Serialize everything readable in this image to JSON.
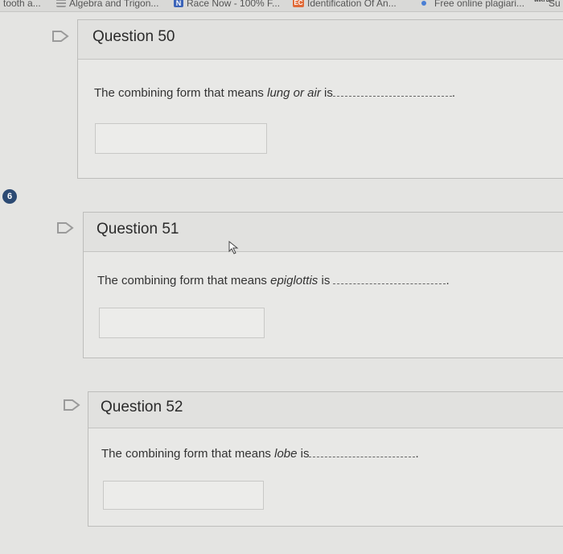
{
  "bookmarks": [
    {
      "label": "tooth a...",
      "icon": "none"
    },
    {
      "label": "Algebra and Trigon...",
      "icon": "stack-icon"
    },
    {
      "label": "Race Now - 100% F...",
      "icon": "n-logo-icon"
    },
    {
      "label": "Identification Of An...",
      "icon": "ec-logo-icon"
    },
    {
      "label": "Free online plagiari...",
      "icon": "blue-dot-icon"
    },
    {
      "label": "Su",
      "icon": "wiki-diff-icon"
    }
  ],
  "wiki_icon_text": "WiKi Diff",
  "ec_logo": "EC",
  "n_logo": "N",
  "badge": "6",
  "questions": [
    {
      "title": "Question 50",
      "text_before": "The combining form that means ",
      "text_italic": "lung or air",
      "text_after": " is",
      "end_mark": "."
    },
    {
      "title": "Question 51",
      "text_before": "The combining form that means ",
      "text_italic": "epiglottis",
      "text_after": " is ",
      "end_mark": "."
    },
    {
      "title": "Question 52",
      "text_before": "The combining form that means ",
      "text_italic": "lobe",
      "text_after": " is",
      "end_mark": "."
    }
  ],
  "colors": {
    "badge": "#2c4a73",
    "flag_stroke": "#9a9a9a"
  }
}
